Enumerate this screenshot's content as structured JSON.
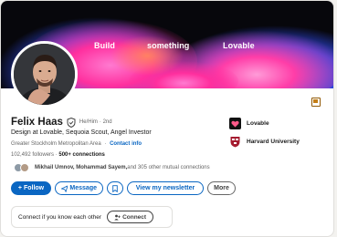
{
  "banner": {
    "words": [
      "Build",
      "something",
      "Lovable"
    ]
  },
  "profile": {
    "name": "Felix Haas",
    "pronouns": "He/Him",
    "degree": "· 2nd",
    "headline": "Design at Lovable, Sequoia Scout, Angel Investor",
    "location": "Greater Stockholm Metropolitan Area",
    "location_separator": "·",
    "contact_info": "Contact info",
    "followers": "102,492 followers",
    "followers_separator": "·",
    "connections": "500+ connections",
    "mutual_names": "Mikhail Umnov, Mohammad Sayem,",
    "mutual_rest": " and 305 other mutual connections"
  },
  "companies": [
    {
      "name": "Lovable",
      "icon": "lovable-logo"
    },
    {
      "name": "Harvard University",
      "icon": "harvard-shield-logo"
    }
  ],
  "actions": {
    "follow": "Follow",
    "follow_icon": "+",
    "message": "Message",
    "bookmark_icon": "bookmark-icon",
    "newsletter": "View my newsletter",
    "more": "More"
  },
  "connect": {
    "prompt": "Connect if you know each other",
    "button": "Connect"
  },
  "colors": {
    "primary": "#0a66c2",
    "banner_bg": "#07070c",
    "banner_pink": "#ff2f9e",
    "banner_blue": "#3b5cff"
  }
}
